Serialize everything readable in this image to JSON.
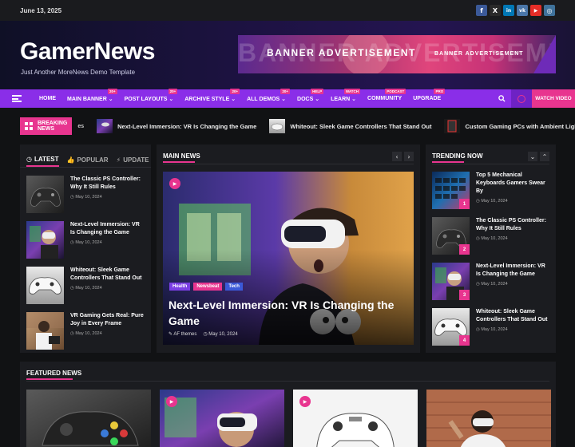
{
  "topbar": {
    "date": "June 13, 2025",
    "socials": [
      {
        "icon": "facebook-icon",
        "glyph": "f",
        "color": "#3b5998"
      },
      {
        "icon": "x-icon",
        "glyph": "X",
        "color": "#2a2a2a"
      },
      {
        "icon": "linkedin-icon",
        "glyph": "in",
        "color": "#0077b5"
      },
      {
        "icon": "vk-icon",
        "glyph": "vk",
        "color": "#4a76a8"
      },
      {
        "icon": "youtube-icon",
        "glyph": "▶",
        "color": "#e52d27"
      },
      {
        "icon": "instagram-icon",
        "glyph": "◎",
        "color": "#3f729b"
      }
    ]
  },
  "header": {
    "logo": "GamerNews",
    "tagline": "Just Another MoreNews Demo Template",
    "banner_ghost": "BANNER ADVERTISEME",
    "banner_main": "BANNER ADVERTISEMENT",
    "banner_small": "BANNER ADVERTISEMENT"
  },
  "nav": {
    "items": [
      {
        "label": "HOME",
        "badge": "",
        "chevron": false
      },
      {
        "label": "MAIN BANNER",
        "badge": "20+",
        "chevron": true
      },
      {
        "label": "POST LAYOUTS",
        "badge": "20+",
        "chevron": true
      },
      {
        "label": "ARCHIVE STYLE",
        "badge": "20+",
        "chevron": true
      },
      {
        "label": "ALL DEMOS",
        "badge": "20+",
        "chevron": true
      },
      {
        "label": "DOCS",
        "badge": "HELP",
        "chevron": true
      },
      {
        "label": "LEARN",
        "badge": "WATCH",
        "chevron": true
      },
      {
        "label": "COMMUNITY",
        "badge": "PODCAST",
        "chevron": false
      },
      {
        "label": "UPGRADE",
        "badge": "PRO",
        "chevron": false
      }
    ],
    "watch_label": "WATCH VIDEO"
  },
  "breaking": {
    "label": "BREAKING NEWS",
    "tail": "es",
    "items": [
      {
        "title": "Next-Level Immersion: VR Is Changing the Game"
      },
      {
        "title": "Whiteout: Sleek Game Controllers That Stand Out"
      },
      {
        "title": "Custom Gaming PCs with Ambient Ligh"
      }
    ]
  },
  "left": {
    "tabs": [
      {
        "label": "LATEST",
        "icon": "clock-icon",
        "glyph": "◷",
        "active": true
      },
      {
        "label": "POPULAR",
        "icon": "thumbs-up-icon",
        "glyph": "👍",
        "active": false
      },
      {
        "label": "UPDATE",
        "icon": "bolt-icon",
        "glyph": "⚡",
        "active": false
      }
    ],
    "items": [
      {
        "title": "The Classic PS Controller: Why It Still Rules",
        "date": "May 10, 2024"
      },
      {
        "title": "Next-Level Immersion: VR Is Changing the Game",
        "date": "May 10, 2024"
      },
      {
        "title": "Whiteout: Sleek Game Controllers That Stand Out",
        "date": "May 10, 2024"
      },
      {
        "title": "VR Gaming Gets Real: Pure Joy in Every Frame",
        "date": "May 10, 2024"
      }
    ]
  },
  "main": {
    "heading": "MAIN NEWS",
    "tags": [
      {
        "label": "Health",
        "color": "#7b3fe4"
      },
      {
        "label": "Newsbeat",
        "color": "#e8358f"
      },
      {
        "label": "Tech",
        "color": "#3b59d8"
      }
    ],
    "title": "Next-Level Immersion: VR Is Changing the Game",
    "author": "AF themes",
    "date": "May 10, 2024"
  },
  "trending": {
    "heading": "TRENDING NOW",
    "items": [
      {
        "title": "Top 5 Mechanical Keyboards Gamers Swear By",
        "date": "May 10, 2024",
        "num": "1"
      },
      {
        "title": "The Classic PS Controller: Why It Still Rules",
        "date": "May 10, 2024",
        "num": "2"
      },
      {
        "title": "Next-Level Immersion: VR Is Changing the Game",
        "date": "May 10, 2024",
        "num": "3"
      },
      {
        "title": "Whiteout: Sleek Game Controllers That Stand Out",
        "date": "May 10, 2024",
        "num": "4"
      }
    ]
  },
  "featured": {
    "heading": "FEATURED NEWS"
  },
  "colors": {
    "accent": "#e8358f",
    "nav": "#8a2ee8"
  }
}
